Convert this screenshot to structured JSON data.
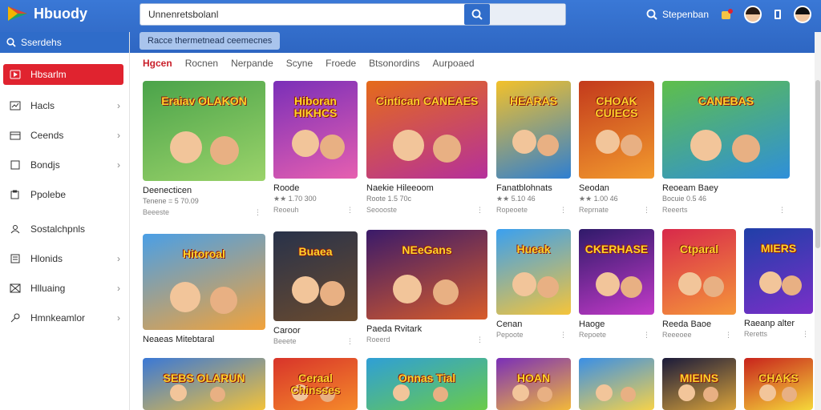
{
  "app": {
    "title": "Hbuody"
  },
  "search": {
    "value": "Unnenretsbolanl",
    "placeholder": ""
  },
  "header": {
    "search_label": "Stepenban"
  },
  "chip": {
    "label": "Racce thermetnead ceemecnes"
  },
  "sidebar": {
    "top_label": "Sserdehs",
    "items": [
      {
        "label": "Hbsarlm",
        "icon": "play-icon",
        "active": true
      },
      {
        "label": "Hacls",
        "icon": "chart-icon",
        "chevron": true
      },
      {
        "label": "Ceends",
        "icon": "calendar-icon",
        "chevron": true
      },
      {
        "label": "Bondjs",
        "icon": "book-icon",
        "chevron": true
      },
      {
        "label": "Ppolebe",
        "icon": "clipboard-icon"
      },
      {
        "label": "Sostalchpnls",
        "icon": "person-icon"
      },
      {
        "label": "Hlonids",
        "icon": "list-icon",
        "chevron": true
      },
      {
        "label": "Hlluaing",
        "icon": "grid-icon",
        "chevron": true
      },
      {
        "label": "Hmnkeamlor",
        "icon": "tag-icon",
        "chevron": true
      }
    ]
  },
  "tabs": [
    "Hgcen",
    "Rocnen",
    "Nerpande",
    "Scyne",
    "Froede",
    "Btsonordins",
    "Aurpoaed"
  ],
  "colors": {
    "header": "#2e66c2",
    "accent_red": "#e0232f",
    "tab_active": "#c91f2a"
  },
  "row1": [
    {
      "thumb_text": "Eraiav OLAKON",
      "title": "Deenecticen",
      "meta": "Tenene = 5 70.09",
      "sub": "Beeeste",
      "bg": [
        "#4aa34a",
        "#9bd36a"
      ]
    },
    {
      "thumb_text": "Hiboran HIKHCS",
      "title": "Roode",
      "meta": "★★ 1.70 300",
      "sub": "Reoeuh",
      "bg": [
        "#7a2fb8",
        "#e65fb0"
      ]
    },
    {
      "thumb_text": "Cintican CANEAES",
      "title": "Naekie Hileeoom",
      "meta": "Roote 1.5 70c",
      "sub": "Seoooste",
      "bg": [
        "#e56b1a",
        "#b5309b"
      ]
    },
    {
      "thumb_text": "HEARAS",
      "title": "Fanatblohnats",
      "meta": "★★ 5.10 46",
      "sub": "Ropeoete",
      "bg": [
        "#f3c12a",
        "#2f7fd1"
      ]
    },
    {
      "thumb_text": "CHOAK CUIECS",
      "title": "Seodan",
      "meta": "★★ 1.00 46",
      "sub": "Reprnate",
      "bg": [
        "#c33a1c",
        "#f29a2e"
      ]
    },
    {
      "thumb_text": "CANEBAS",
      "title": "Reoeam Baey",
      "meta": "Bocuie 0.5 46",
      "sub": "Reeerts",
      "bg": [
        "#5fbf4a",
        "#2f8fd9"
      ]
    }
  ],
  "row2": [
    {
      "thumb_text": "Hitoroal",
      "title": "Neaeas Mitebtaral",
      "sub": "",
      "bg": [
        "#4a9fe6",
        "#f2a23a"
      ]
    },
    {
      "thumb_text": "Buaea",
      "title": "Caroor",
      "sub": "Beeete",
      "bg": [
        "#28324a",
        "#6a4a2e"
      ]
    },
    {
      "thumb_text": "NEeGans",
      "title": "Paeda Rvitark",
      "sub": "Roeerd",
      "bg": [
        "#3a1a6a",
        "#d85c2a"
      ]
    },
    {
      "thumb_text": "Hueak",
      "title": "Cenan",
      "sub": "Pepoote",
      "bg": [
        "#3aa0f0",
        "#f5c43a"
      ]
    },
    {
      "thumb_text": "CKERHASE",
      "title": "Haoge",
      "sub": "Repoete",
      "bg": [
        "#2f1a6a",
        "#c23ac8"
      ]
    },
    {
      "thumb_text": "Ctparal",
      "title": "Reeda Baoe",
      "sub": "Reeeoee",
      "bg": [
        "#d8294a",
        "#f5963a"
      ]
    },
    {
      "thumb_text": "MIERS",
      "title": "Raeanp alter",
      "sub": "Reretts",
      "bg": [
        "#1f3fa8",
        "#7a2fc8"
      ]
    }
  ],
  "row3": [
    {
      "thumb_text": "SEBS OLARUN",
      "bg": [
        "#3a78d6",
        "#f2c23a"
      ]
    },
    {
      "thumb_text": "Ceraal Chinsses",
      "bg": [
        "#d8342a",
        "#f58a2a"
      ]
    },
    {
      "thumb_text": "Onnas Tial",
      "bg": [
        "#2f9fd6",
        "#6acb4a"
      ]
    },
    {
      "thumb_text": "HOAN",
      "bg": [
        "#7a2fb8",
        "#f2b83a"
      ]
    },
    {
      "thumb_text": "",
      "bg": [
        "#3a8fe6",
        "#f5d24a"
      ]
    },
    {
      "thumb_text": "MIEINS",
      "bg": [
        "#1a1a3a",
        "#d8a23a"
      ]
    },
    {
      "thumb_text": "CHAKS",
      "bg": [
        "#c8231c",
        "#f5d83a"
      ]
    }
  ]
}
